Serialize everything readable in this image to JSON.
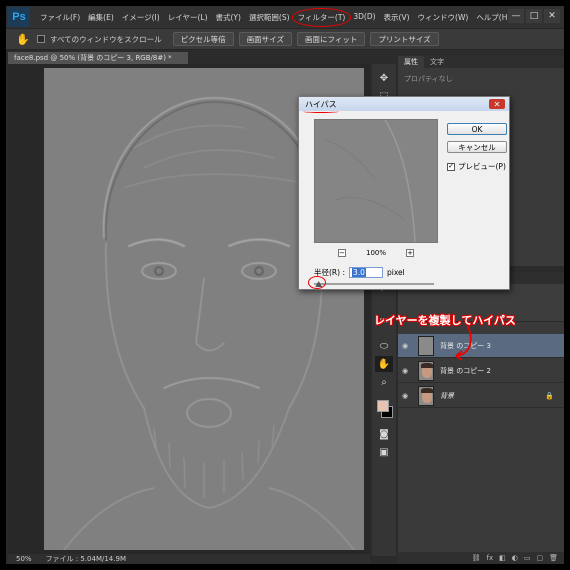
{
  "app": {
    "logo": "Ps"
  },
  "menu": [
    "ファイル(F)",
    "編集(E)",
    "イメージ(I)",
    "レイヤー(L)",
    "書式(Y)",
    "選択範囲(S)",
    "フィルター(T)",
    "3D(D)",
    "表示(V)",
    "ウィンドウ(W)",
    "ヘルプ(H)"
  ],
  "window_controls": {
    "minimize": "—",
    "maximize": "□",
    "close": "✕"
  },
  "options": {
    "scroll_all_label": "すべてのウィンドウをスクロール",
    "buttons": [
      "ピクセル等倍",
      "画面サイズ",
      "画面にフィット",
      "プリントサイズ"
    ]
  },
  "document": {
    "tab_title": "face8.psd @ 50% (背景 のコピー 3, RGB/8#) *",
    "tab_close": "×"
  },
  "status": {
    "zoom": "50%",
    "file_info": "ファイル : 5.04M/14.9M"
  },
  "properties_panel": {
    "tabs": [
      "属性",
      "文字"
    ],
    "empty_text": "プロパティなし"
  },
  "layers": [
    {
      "name": "背景 のコピー 3",
      "selected": true,
      "thumb": "gray",
      "italic": false
    },
    {
      "name": "背景 のコピー 2",
      "selected": false,
      "thumb": "face",
      "italic": false
    },
    {
      "name": "背景",
      "selected": false,
      "thumb": "face",
      "italic": true,
      "locked": true
    }
  ],
  "annotation": {
    "text": "レイヤーを複製してハイパス"
  },
  "dialog": {
    "title": "ハイパス",
    "close": "✕",
    "ok_label": "OK",
    "cancel_label": "キャンセル",
    "preview_label": "プレビュー(P)",
    "preview_checked": true,
    "zoom_minus": "−",
    "zoom_plus": "+",
    "zoom_level": "100%",
    "radius_label": "半径(R) :",
    "radius_value": "3.0",
    "radius_unit": "pixel",
    "slider_fraction": 0.01
  },
  "colors": {
    "foreground": "#e6c3b3",
    "background": "#000000",
    "annotation_outline": "#e00000"
  }
}
